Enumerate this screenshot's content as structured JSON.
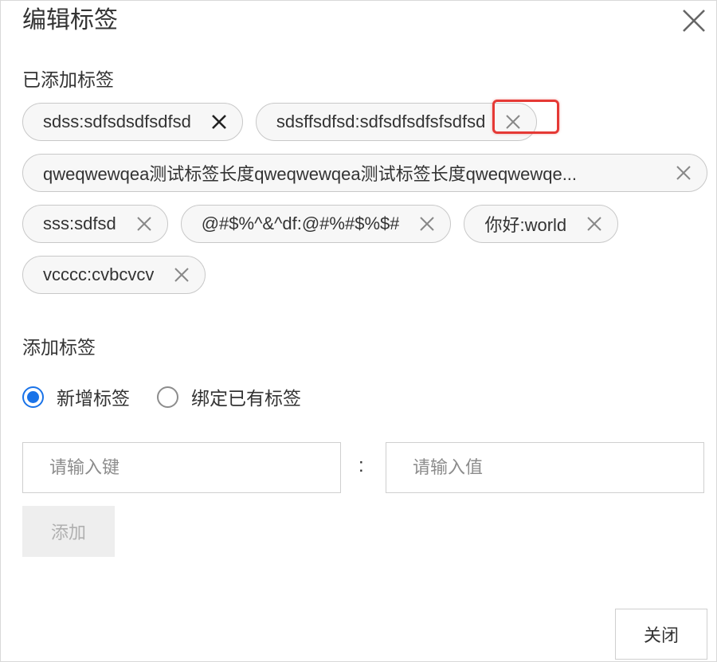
{
  "dialog": {
    "title": "编辑标签"
  },
  "added": {
    "label": "已添加标签",
    "tags": [
      {
        "text": "sdss:sdfsdsdfsdfsd"
      },
      {
        "text": "sdsffsdfsd:sdfsdfsdfsfsdfsd"
      },
      {
        "text": "qweqwewqea测试标签长度qweqwewqea测试标签长度qweqwewqe..."
      },
      {
        "text": "sss:sdfsd"
      },
      {
        "text": "@#$%^&^df:@#%#$%$#"
      },
      {
        "text": "你好:world"
      },
      {
        "text": "vcccc:cvbcvcv"
      }
    ]
  },
  "add": {
    "label": "添加标签",
    "radio_new": "新增标签",
    "radio_bind": "绑定已有标签",
    "selected": "新增标签",
    "key_placeholder": "请输入键",
    "value_placeholder": "请输入值",
    "separator": ":",
    "button": "添加"
  },
  "footer": {
    "close_button": "关闭"
  },
  "colors": {
    "accent": "#1a73e8",
    "highlight": "#e53935"
  }
}
